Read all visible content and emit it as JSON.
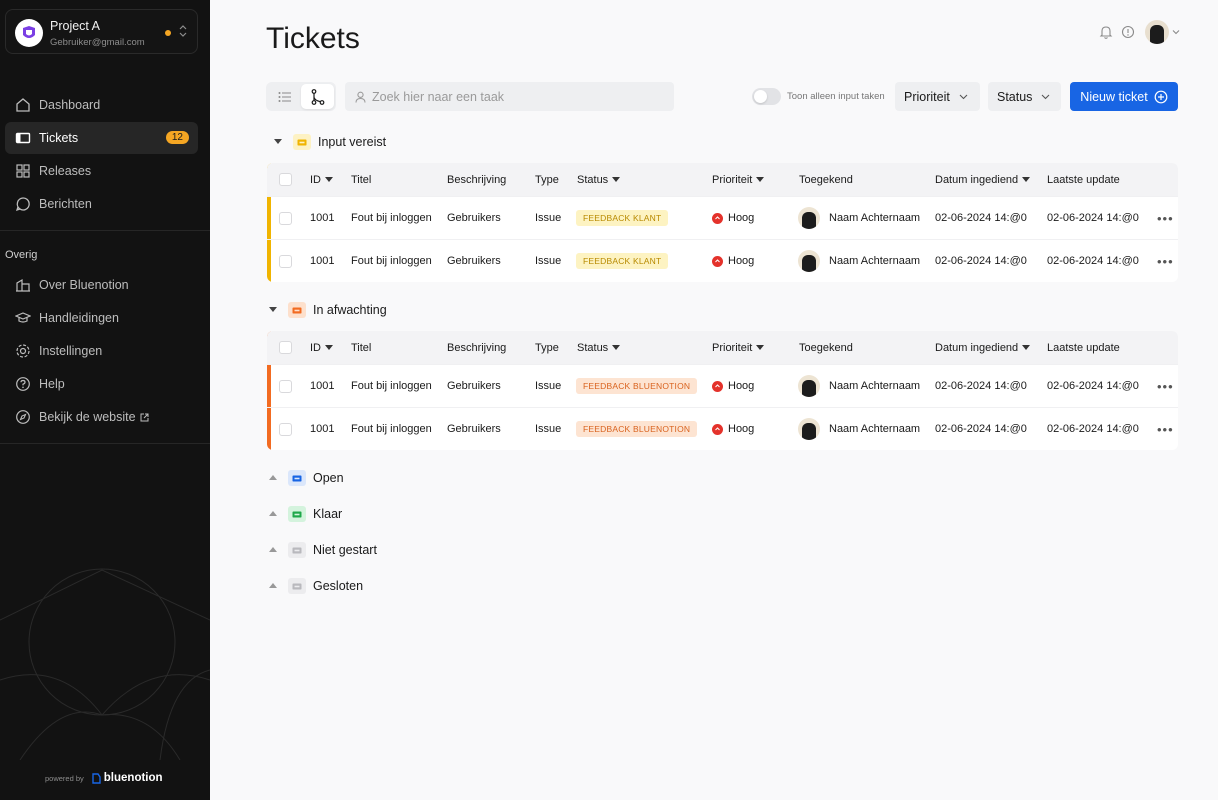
{
  "colors": {
    "sidebar_bg": "#121212",
    "accent": "#1865e4",
    "badge": "#f5a623",
    "input_required": "#f0b400",
    "pending": "#f26b21",
    "priority_high": "#e4322b"
  },
  "project": {
    "name": "Project A",
    "email": "Gebruiker@gmail.com"
  },
  "nav": {
    "main": [
      {
        "label": "Dashboard",
        "icon": "home-icon"
      },
      {
        "label": "Tickets",
        "icon": "ticket-icon",
        "badge": "12",
        "active": true
      },
      {
        "label": "Releases",
        "icon": "grid-icon"
      },
      {
        "label": "Berichten",
        "icon": "chat-icon"
      }
    ],
    "section_label": "Overig",
    "other": [
      {
        "label": "Over Bluenotion",
        "icon": "building-icon"
      },
      {
        "label": "Handleidingen",
        "icon": "graduation-cap-icon"
      },
      {
        "label": "Instellingen",
        "icon": "gear-icon"
      },
      {
        "label": "Help",
        "icon": "question-icon"
      },
      {
        "label": "Bekijk de website",
        "icon": "compass-icon"
      }
    ]
  },
  "powered_by": {
    "prefix": "powered by",
    "brand": "bluenotion"
  },
  "page": {
    "title": "Tickets"
  },
  "toolbar": {
    "search_placeholder": "Zoek hier naar een taak",
    "toggle_label": "Toon alleen input taken",
    "priority_label": "Prioriteit",
    "status_label": "Status",
    "new_ticket_label": "Nieuw ticket"
  },
  "columns": [
    "ID",
    "Titel",
    "Beschrijving",
    "Type",
    "Status",
    "Prioriteit",
    "Toegekend",
    "Datum ingediend",
    "Laatste update"
  ],
  "groups": [
    {
      "label": "Input vereist",
      "expanded": true,
      "rows": [
        {
          "id": "1001",
          "title": "Fout bij inloggen",
          "description": "Gebruikers",
          "type": "Issue",
          "status": "FEEDBACK KLANT",
          "priority": "Hoog",
          "assignee": "Naam Achternaam",
          "submitted": "02-06-2024 14:@0",
          "updated": "02-06-2024 14:@0"
        },
        {
          "id": "1001",
          "title": "Fout bij inloggen",
          "description": "Gebruikers",
          "type": "Issue",
          "status": "FEEDBACK KLANT",
          "priority": "Hoog",
          "assignee": "Naam Achternaam",
          "submitted": "02-06-2024 14:@0",
          "updated": "02-06-2024 14:@0"
        }
      ]
    },
    {
      "label": "In afwachting",
      "expanded": true,
      "rows": [
        {
          "id": "1001",
          "title": "Fout bij inloggen",
          "description": "Gebruikers",
          "type": "Issue",
          "status": "FEEDBACK BLUENOTION",
          "priority": "Hoog",
          "assignee": "Naam Achternaam",
          "submitted": "02-06-2024 14:@0",
          "updated": "02-06-2024 14:@0"
        },
        {
          "id": "1001",
          "title": "Fout bij inloggen",
          "description": "Gebruikers",
          "type": "Issue",
          "status": "FEEDBACK BLUENOTION",
          "priority": "Hoog",
          "assignee": "Naam Achternaam",
          "submitted": "02-06-2024 14:@0",
          "updated": "02-06-2024 14:@0"
        }
      ]
    },
    {
      "label": "Open",
      "expanded": false
    },
    {
      "label": "Klaar",
      "expanded": false
    },
    {
      "label": "Niet gestart",
      "expanded": false
    },
    {
      "label": "Gesloten",
      "expanded": false
    }
  ]
}
